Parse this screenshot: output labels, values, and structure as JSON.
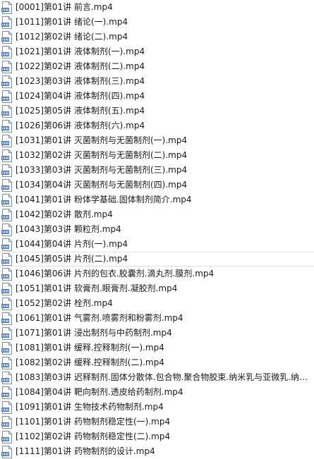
{
  "files": [
    {
      "name": "[0001]第01讲 前言.mp4",
      "icon": "mp4-file-icon"
    },
    {
      "name": "[1011]第01讲 绪论(一).mp4",
      "icon": "mp4-file-icon"
    },
    {
      "name": "[1012]第02讲 绪论(二).mp4",
      "icon": "mp4-file-icon"
    },
    {
      "name": "[1021]第01讲 液体制剂(一).mp4",
      "icon": "mp4-file-icon"
    },
    {
      "name": "[1022]第02讲 液体制剂(二).mp4",
      "icon": "mp4-file-icon"
    },
    {
      "name": "[1023]第03讲 液体制剂(三).mp4",
      "icon": "mp4-file-icon"
    },
    {
      "name": "[1024]第04讲 液体制剂(四).mp4",
      "icon": "mp4-file-icon"
    },
    {
      "name": "[1025]第05讲 液体制剂(五).mp4",
      "icon": "mp4-file-icon"
    },
    {
      "name": "[1026]第06讲 液体制剂(六).mp4",
      "icon": "mp4-file-icon"
    },
    {
      "name": "[1031]第01讲 灭菌制剂与无菌制剂(一).mp4",
      "icon": "mp4-file-icon"
    },
    {
      "name": "[1032]第02讲 灭菌制剂与无菌制剂(二).mp4",
      "icon": "mp4-file-icon"
    },
    {
      "name": "[1033]第03讲 灭菌制剂与无菌制剂(三).mp4",
      "icon": "mp4-file-icon"
    },
    {
      "name": "[1034]第04讲 灭菌制剂与无菌制剂(四).mp4",
      "icon": "mp4-file-icon"
    },
    {
      "name": "[1041]第01讲 粉体学基础.固体制剂简介.mp4",
      "icon": "mp4-file-icon"
    },
    {
      "name": "[1042]第02讲 散剂.mp4",
      "icon": "mp4-file-icon"
    },
    {
      "name": "[1043]第03讲 颗粒剂.mp4",
      "icon": "mp4-file-icon"
    },
    {
      "name": "[1044]第04讲 片剂(一).mp4",
      "icon": "mp4-file-icon"
    },
    {
      "name": "[1045]第05讲 片剂(二).mp4",
      "icon": "mp4-file-icon"
    },
    {
      "name": "[1046]第06讲 片剂的包衣.胶囊剂.滴丸剂.膜剂.mp4",
      "icon": "mp4-file-icon"
    },
    {
      "name": "[1051]第01讲 软膏剂.眼膏剂.凝胶剂.mp4",
      "icon": "mp4-file-icon"
    },
    {
      "name": "[1052]第02讲 栓剂.mp4",
      "icon": "mp4-file-icon"
    },
    {
      "name": "[1061]第01讲 气雾剂.喷雾剂和粉雾剂.mp4",
      "icon": "mp4-file-icon"
    },
    {
      "name": "[1071]第01讲 浸出制剂与中药制剂.mp4",
      "icon": "mp4-file-icon"
    },
    {
      "name": "[1081]第01讲 缓释.控释制剂(一).mp4",
      "icon": "mp4-file-icon"
    },
    {
      "name": "[1082]第02讲 缓释.控释制剂(二).mp4",
      "icon": "mp4-file-icon"
    },
    {
      "name": "[1083]第03讲 迟释制剂.固体分散体.包合物.聚合物胶束.纳米乳与亚微乳.纳米粒..",
      "icon": "mp4-file-icon"
    },
    {
      "name": "[1084]第04讲 靶向制剂.透皮给药制剂.mp4",
      "icon": "mp4-file-icon"
    },
    {
      "name": "[1091]第01讲 生物技术药物制剂.mp4",
      "icon": "mp4-file-icon"
    },
    {
      "name": "[1101]第01讲 药物制剂稳定性(一).mp4",
      "icon": "mp4-file-icon"
    },
    {
      "name": "[1102]第02讲 药物制剂稳定性(二).mp4",
      "icon": "mp4-file-icon"
    },
    {
      "name": "[1111]第01讲 药物制剂的设计.mp4",
      "icon": "mp4-file-icon"
    }
  ],
  "hovered_index": 17,
  "colors": {
    "icon_body": "#ffffff",
    "icon_border": "#7f8fa6",
    "icon_badge": "#4a78c2",
    "hover_border": "#cfe6f7"
  }
}
